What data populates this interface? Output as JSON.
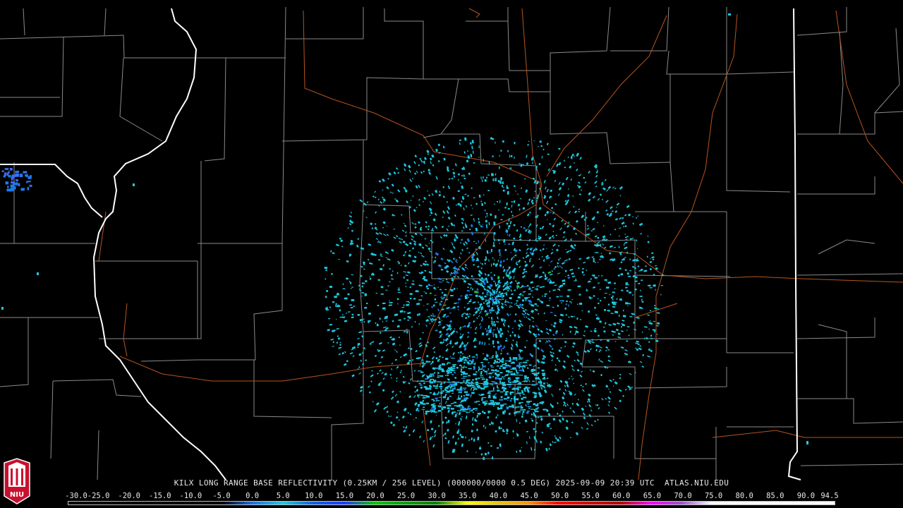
{
  "caption": "KILX LONG RANGE BASE REFLECTIVITY (0.25KM / 256 LEVEL) (000000/0000 0.5 DEG) 2025-09-09 20:39 UTC  ATLAS.NIU.EDU",
  "logo_text": "NIU",
  "scale_labels": [
    "-30.0",
    "-25.0",
    "-20.0",
    "-15.0",
    "-10.0",
    "-5.0",
    "0.0",
    "5.0",
    "10.0",
    "15.0",
    "20.0",
    "25.0",
    "30.0",
    "35.0",
    "40.0",
    "45.0",
    "50.0",
    "55.0",
    "60.0",
    "65.0",
    "70.0",
    "75.0",
    "80.0",
    "85.0",
    "90.0",
    "94.5"
  ],
  "colors": {
    "background": "#000000",
    "county_lines": "#8a8a8a",
    "state_lines": "#ffffff",
    "highways": "#b5551f",
    "echo_light": "#1ec8e0",
    "echo_medium": "#1e7ae6",
    "echo_strong": "#22c83a",
    "logo_red": "#c8102e"
  },
  "scale_gradient": [
    "#000000",
    "#000000",
    "#000000",
    "#000000",
    "#000000",
    "#000000",
    "#1e6fe6",
    "#1ecbe1",
    "#0d5fe6",
    "#1e3cff",
    "#00c800",
    "#00a000",
    "#008200",
    "#ffff00",
    "#e6c800",
    "#ff9600",
    "#ff0000",
    "#d20000",
    "#b40000",
    "#ff00ff",
    "#9a55cc",
    "#ffffff",
    "#ffffff",
    "#ffffff",
    "#ffffff",
    "#ffffff"
  ]
}
